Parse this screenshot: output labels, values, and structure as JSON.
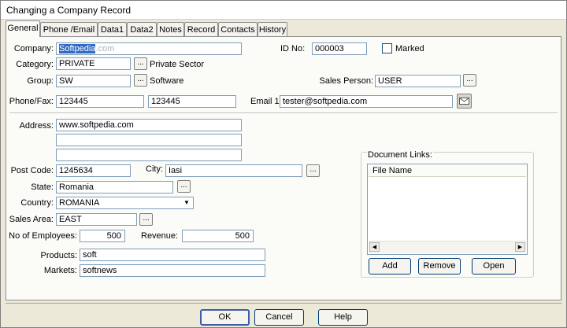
{
  "window": {
    "title": "Changing a Company  Record"
  },
  "tabs": [
    "General",
    "Phone /Email",
    "Data1",
    "Data2",
    "Notes",
    "Record",
    "Contacts",
    "History"
  ],
  "form": {
    "company_label": "Company:",
    "company_value_selected": "Softpedia",
    "company_value_ghost": ".com",
    "idno_label": "ID No:",
    "idno_value": "000003",
    "marked_label": "Marked",
    "category_label": "Category:",
    "category_value": "PRIVATE",
    "category_desc": "Private Sector",
    "group_label": "Group:",
    "group_value": "SW",
    "group_desc": "Software",
    "salesperson_label": "Sales Person:",
    "salesperson_value": "USER",
    "phonefax_label": "Phone/Fax:",
    "phone_value": "123445",
    "fax_value": "123445",
    "email_label": "Email 1:",
    "email_value": "tester@softpedia.com",
    "address_label": "Address:",
    "address_line1": "www.softpedia.com",
    "address_line2": "",
    "address_line3": "",
    "postcode_label": "Post Code:",
    "postcode_value": "1245634",
    "city_label": "City:",
    "city_value": "Iasi",
    "state_label": "State:",
    "state_value": "Romania",
    "country_label": "Country:",
    "country_value": "ROMANIA",
    "salesarea_label": "Sales Area:",
    "salesarea_value": "EAST",
    "employees_label": "No of Employees:",
    "employees_value": "500",
    "revenue_label": "Revenue:",
    "revenue_value": "500",
    "products_label": "Products:",
    "products_value": "soft",
    "markets_label": "Markets:",
    "markets_value": "softnews",
    "ellipsis": "..."
  },
  "document_links": {
    "title": "Document Links:",
    "column": "File Name",
    "add": "Add",
    "remove": "Remove",
    "open": "Open"
  },
  "footer": {
    "ok": "OK",
    "cancel": "Cancel",
    "help": "Help"
  },
  "icons": {
    "dropdown": "chevron-down-icon",
    "scroll_left": "arrow-left-icon",
    "scroll_right": "arrow-right-icon",
    "email": "envelope-icon"
  },
  "colors": {
    "selection": "#316ac5",
    "input_border": "#7f9db9",
    "dialog_bg": "#ece9d8"
  }
}
